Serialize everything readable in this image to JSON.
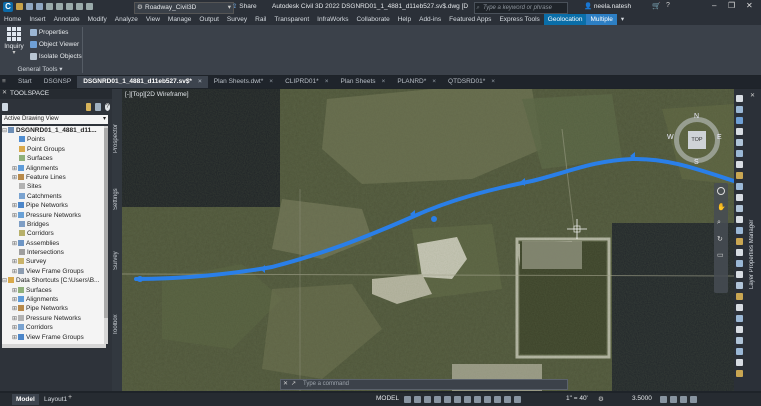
{
  "app": {
    "logo_letter": "C",
    "workspace": "Roadway_Civil3D",
    "share_label": "Share",
    "title": "Autodesk Civil 3D 2022   DSGNRD01_1_4881_d11eb527.sv$.dwg [DS1]",
    "search_placeholder": "Type a keyword or phrase",
    "user": "neela.natesh"
  },
  "ribbon_tabs": [
    "Home",
    "Insert",
    "Annotate",
    "Modify",
    "Analyze",
    "View",
    "Manage",
    "Output",
    "Survey",
    "Rail",
    "Transparent",
    "InfraWorks",
    "Collaborate",
    "Help",
    "Add-ins",
    "Featured Apps",
    "Express Tools",
    "Geolocation",
    "Multiple"
  ],
  "ribbon_panel": {
    "big_button": "Inquiry",
    "items": [
      "Properties",
      "Object Viewer",
      "Isolate Objects"
    ],
    "panel_title": "General Tools"
  },
  "doc_tabs": [
    {
      "label": "Start",
      "closable": false
    },
    {
      "label": "DSGNSP",
      "closable": false
    },
    {
      "label": "DSGNRD01_1_4881_d11eb527.sv$*",
      "closable": true,
      "active": true
    },
    {
      "label": "Plan Sheets.dwt*",
      "closable": true
    },
    {
      "label": "CLIPRD01*",
      "closable": true
    },
    {
      "label": "Plan Sheets",
      "closable": true
    },
    {
      "label": "PLANRD*",
      "closable": true
    },
    {
      "label": "QTDSRD01*",
      "closable": true
    }
  ],
  "toolspace": {
    "title": "TOOLSPACE",
    "view_select": "Active Drawing View",
    "drawing_name": "DSGNRD01_1_4881_d11...",
    "items": [
      "Points",
      "Point Groups",
      "Surfaces",
      "Alignments",
      "Feature Lines",
      "Sites",
      "Catchments",
      "Pipe Networks",
      "Pressure Networks",
      "Bridges",
      "Corridors",
      "Assemblies",
      "Intersections",
      "Survey",
      "View Frame Groups"
    ],
    "data_shortcuts": "Data Shortcuts [C:\\Users\\B...",
    "ds_items": [
      "Surfaces",
      "Alignments",
      "Pipe Networks",
      "Pressure Networks",
      "Corridors",
      "View Frame Groups"
    ]
  },
  "vertical_tabs": [
    "Prospector",
    "Settings",
    "Survey",
    "Toolbox"
  ],
  "viewport": {
    "label": "[-][Top][2D Wireframe]",
    "viewcube_top": "TOP",
    "compass": [
      "N",
      "W",
      "E",
      "S"
    ],
    "command_placeholder": "Type a command"
  },
  "right_palette_title": "Layer Properties Manager",
  "layout_tabs": [
    "Model",
    "Layout1"
  ],
  "status": {
    "model": "MODEL",
    "scale": "1\" = 40'",
    "elevation": "3.5000"
  },
  "colors": {
    "accent": "#0a6ea8",
    "alignment": "#2a7fe8",
    "tree_bg": "#f4f4f4"
  }
}
